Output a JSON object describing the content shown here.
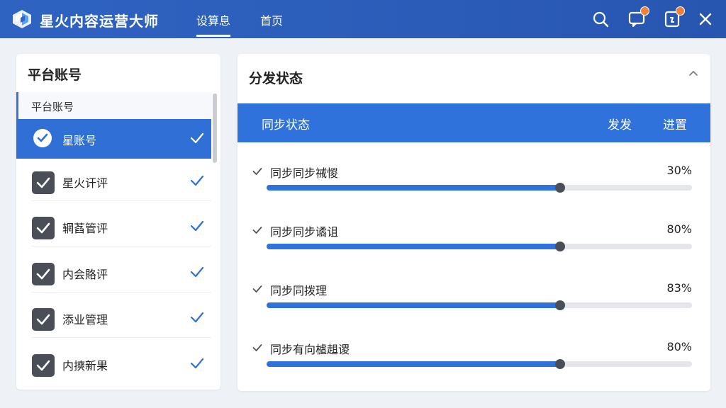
{
  "header": {
    "app_title": "星火内容运营大师",
    "tabs": [
      {
        "label": "设算息",
        "active": true
      },
      {
        "label": "首页",
        "active": false
      }
    ],
    "icons": [
      "search-icon",
      "chat-icon",
      "document-icon",
      "close-icon"
    ]
  },
  "left_panel": {
    "title": "平台账号",
    "list_header": "平台账号",
    "items": [
      {
        "label": "星账号",
        "selected": true
      },
      {
        "label": "星火讦评",
        "selected": false
      },
      {
        "label": "辋萏管评",
        "selected": false
      },
      {
        "label": "内会賂评",
        "selected": false
      },
      {
        "label": "添业管理",
        "selected": false
      },
      {
        "label": "内摤新果",
        "selected": false
      }
    ]
  },
  "right_panel": {
    "title": "分发状态",
    "sync_header": {
      "label": "同步状态",
      "col_1": "发发",
      "col_2": "进置"
    },
    "progress_items": [
      {
        "label": "同步同步祴惾",
        "percent_text": "30%",
        "value": 0.69
      },
      {
        "label": "同步同步谲诅",
        "percent_text": "80%",
        "value": 0.69
      },
      {
        "label": "同步同拨理",
        "percent_text": "83%",
        "value": 0.69
      },
      {
        "label": "同步有向樝趄谡",
        "percent_text": "80%",
        "value": 0.69
      }
    ]
  },
  "colors": {
    "header_bg": "#2b5cb8",
    "accent": "#2f72dc",
    "badge": "#f0823a",
    "checkbox": "#4a4f57"
  }
}
